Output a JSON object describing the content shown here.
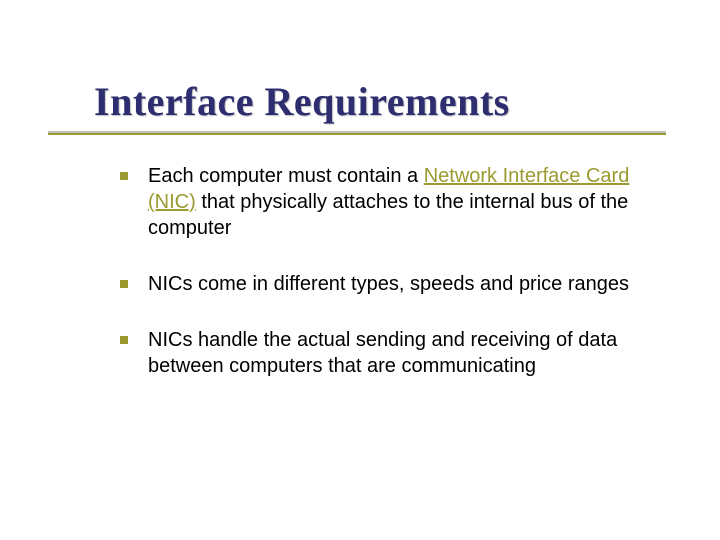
{
  "slide": {
    "title": "Interface Requirements",
    "bullets": [
      {
        "pre": "Each computer must contain a ",
        "link": "Network Interface Card (NIC)",
        "post": " that physically attaches to the internal bus of the computer"
      },
      {
        "pre": "NICs come in different types, speeds and price ranges",
        "link": "",
        "post": ""
      },
      {
        "pre": "NICs handle the actual sending and receiving of data between computers that are communicating",
        "link": "",
        "post": ""
      }
    ]
  }
}
